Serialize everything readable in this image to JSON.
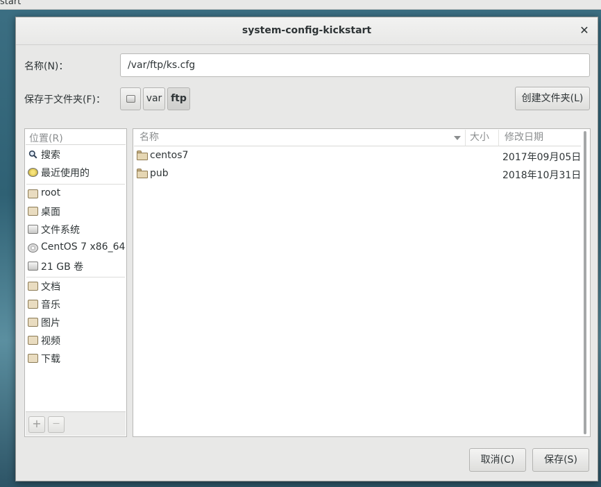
{
  "background_window": {
    "title": "start"
  },
  "dialog": {
    "title": "system-config-kickstart",
    "name_label": "名称(N)：",
    "name_value": "/var/ftp/ks.cfg",
    "save_in_label": "保存于文件夹(F)：",
    "path": [
      {
        "label": "",
        "icon": "drive-icon"
      },
      {
        "label": "var"
      },
      {
        "label": "ftp",
        "active": true
      }
    ],
    "create_folder_button": "创建文件夹(L)",
    "cancel_button": "取消(C)",
    "save_button": "保存(S)"
  },
  "places": {
    "header": "位置(R)",
    "items": [
      {
        "label": "搜索",
        "icon": "search-icon"
      },
      {
        "label": "最近使用的",
        "icon": "recent-icon"
      },
      {
        "label": "root",
        "icon": "home-folder-icon"
      },
      {
        "label": "桌面",
        "icon": "desktop-folder-icon"
      },
      {
        "label": "文件系统",
        "icon": "filesystem-drive-icon"
      },
      {
        "label": "CentOS 7 x86_64",
        "icon": "optical-disc-icon"
      },
      {
        "label": "21 GB 卷",
        "icon": "volume-drive-icon"
      },
      {
        "label": "文档",
        "icon": "documents-folder-icon"
      },
      {
        "label": "音乐",
        "icon": "music-folder-icon"
      },
      {
        "label": "图片",
        "icon": "pictures-folder-icon"
      },
      {
        "label": "视频",
        "icon": "videos-folder-icon"
      },
      {
        "label": "下载",
        "icon": "downloads-folder-icon"
      }
    ],
    "add_button": "+",
    "remove_button": "—"
  },
  "files": {
    "columns": {
      "name": "名称",
      "size": "大小",
      "modified": "修改日期"
    },
    "rows": [
      {
        "name": "centos7",
        "size": "",
        "modified": "2017年09月05日"
      },
      {
        "name": "pub",
        "size": "",
        "modified": "2018年10月31日"
      }
    ]
  }
}
